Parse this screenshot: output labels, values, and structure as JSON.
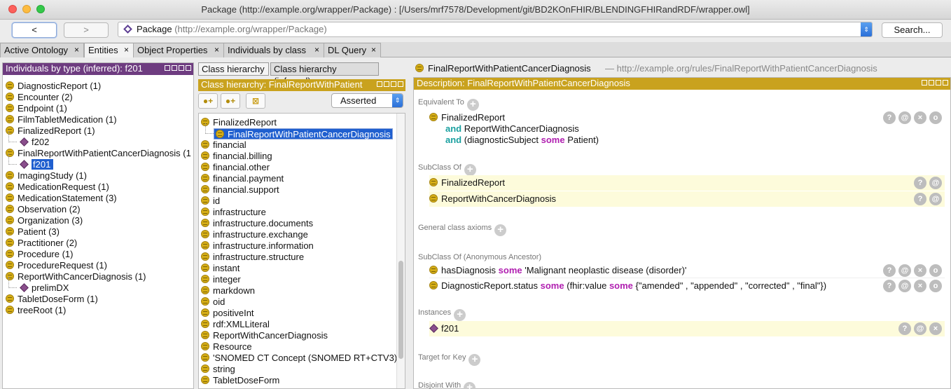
{
  "window": {
    "title": "Package (http://example.org/wrapper/Package)  : [/Users/mrf7578/Development/git/BD2KOnFHIR/BLENDINGFHIRandRDF/wrapper.owl]"
  },
  "nav": {
    "back_label": "<",
    "forward_label": ">",
    "address_name": "Package",
    "address_url": "(http://example.org/wrapper/Package)",
    "search_label": "Search..."
  },
  "tabs": [
    {
      "label": "Active Ontology",
      "active": false
    },
    {
      "label": "Entities",
      "active": true
    },
    {
      "label": "Object Properties",
      "active": false
    },
    {
      "label": "Individuals by class",
      "active": false
    },
    {
      "label": "DL Query",
      "active": false
    }
  ],
  "close_glyph": "×",
  "left_panel": {
    "header": "Individuals by type (inferred): f201",
    "items": [
      {
        "label": "DiagnosticReport (1)",
        "kind": "class"
      },
      {
        "label": "Encounter (2)",
        "kind": "class"
      },
      {
        "label": "Endpoint (1)",
        "kind": "class"
      },
      {
        "label": "FilmTabletMedication (1)",
        "kind": "class"
      },
      {
        "label": "FinalizedReport (1)",
        "kind": "class"
      },
      {
        "label": "f202",
        "kind": "individual"
      },
      {
        "label": "FinalReportWithPatientCancerDiagnosis (1",
        "kind": "class"
      },
      {
        "label": "f201",
        "kind": "individual",
        "selected": true
      },
      {
        "label": "ImagingStudy (1)",
        "kind": "class"
      },
      {
        "label": "MedicationRequest (1)",
        "kind": "class"
      },
      {
        "label": "MedicationStatement (3)",
        "kind": "class"
      },
      {
        "label": "Observation (2)",
        "kind": "class"
      },
      {
        "label": "Organization (3)",
        "kind": "class"
      },
      {
        "label": "Patient (3)",
        "kind": "class"
      },
      {
        "label": "Practitioner (2)",
        "kind": "class"
      },
      {
        "label": "Procedure (1)",
        "kind": "class"
      },
      {
        "label": "ProcedureRequest (1)",
        "kind": "class"
      },
      {
        "label": "ReportWithCancerDiagnosis (1)",
        "kind": "class"
      },
      {
        "label": "prelimDX",
        "kind": "individual"
      },
      {
        "label": "TabletDoseForm (1)",
        "kind": "class"
      },
      {
        "label": "treeRoot (1)",
        "kind": "class"
      }
    ]
  },
  "mid_panel": {
    "subtabs": [
      {
        "label": "Class hierarchy",
        "active": true
      },
      {
        "label": "Class hierarchy (inferred)",
        "active": false
      }
    ],
    "header": "Class hierarchy: FinalReportWithPatient",
    "asserted_label": "Asserted",
    "tool_icons": [
      "add-subclass-icon",
      "add-sibling-icon",
      "delete-class-icon"
    ],
    "items": [
      {
        "label": "FinalizedReport",
        "indent": 0
      },
      {
        "label": "FinalReportWithPatientCancerDiagnosis",
        "indent": 1,
        "selected": true
      },
      {
        "label": "financial",
        "indent": 0
      },
      {
        "label": "financial.billing",
        "indent": 0
      },
      {
        "label": "financial.other",
        "indent": 0
      },
      {
        "label": "financial.payment",
        "indent": 0
      },
      {
        "label": "financial.support",
        "indent": 0
      },
      {
        "label": "id",
        "indent": 0
      },
      {
        "label": "infrastructure",
        "indent": 0
      },
      {
        "label": "infrastructure.documents",
        "indent": 0
      },
      {
        "label": "infrastructure.exchange",
        "indent": 0
      },
      {
        "label": "infrastructure.information",
        "indent": 0
      },
      {
        "label": "infrastructure.structure",
        "indent": 0
      },
      {
        "label": "instant",
        "indent": 0
      },
      {
        "label": "integer",
        "indent": 0
      },
      {
        "label": "markdown",
        "indent": 0
      },
      {
        "label": "oid",
        "indent": 0
      },
      {
        "label": "positiveInt",
        "indent": 0
      },
      {
        "label": "rdf:XMLLiteral",
        "indent": 0
      },
      {
        "label": "ReportWithCancerDiagnosis",
        "indent": 0
      },
      {
        "label": "Resource",
        "indent": 0
      },
      {
        "label": "'SNOMED CT Concept (SNOMED RT+CTV3)'",
        "indent": 0
      },
      {
        "label": "string",
        "indent": 0
      },
      {
        "label": "TabletDoseForm",
        "indent": 0
      }
    ]
  },
  "right_panel": {
    "entity_name": "FinalReportWithPatientCancerDiagnosis",
    "entity_iri": "— http://example.org/rules/FinalReportWithPatientCancerDiagnosis",
    "header": "Description: FinalReportWithPatientCancerDiagnosis",
    "sections": {
      "equivalent_to": "Equivalent To",
      "subclass_of": "SubClass Of",
      "general_axioms": "General class axioms",
      "anon_ancestor": "SubClass Of (Anonymous Ancestor)",
      "instances": "Instances",
      "target_for_key": "Target for Key",
      "disjoint_with": "Disjoint With"
    },
    "equivalent": {
      "class": "FinalizedReport",
      "and1": "and",
      "line2": "ReportWithCancerDiagnosis",
      "and2": "and",
      "line3_pre": "(diagnosticSubject",
      "some": "some",
      "line3_post": "Patient)"
    },
    "subclasses": [
      "FinalizedReport",
      "ReportWithCancerDiagnosis"
    ],
    "ancestor1": {
      "prop": "hasDiagnosis",
      "some": "some",
      "filler": "'Malignant neoplastic disease (disorder)'"
    },
    "ancestor2": {
      "prop": "DiagnosticReport.status",
      "some1": "some",
      "mid": "(fhir:value",
      "some2": "some",
      "filler": "{\"amended\" , \"appended\" , \"corrected\" , \"final\"})"
    },
    "instances": [
      "f201"
    ],
    "btn_labels": {
      "help": "?",
      "annotate": "@",
      "delete": "×",
      "edit": "o"
    },
    "plus_label": "+"
  },
  "colors": {
    "class_icon": "#d6ae16",
    "individual_icon": "#8a4e8c",
    "selection": "#1f5fcf",
    "purple_header": "#6e3c80",
    "gold_header": "#c9a21e",
    "keyword_and": "#1aa0a0",
    "keyword_some": "#b01fb0"
  }
}
